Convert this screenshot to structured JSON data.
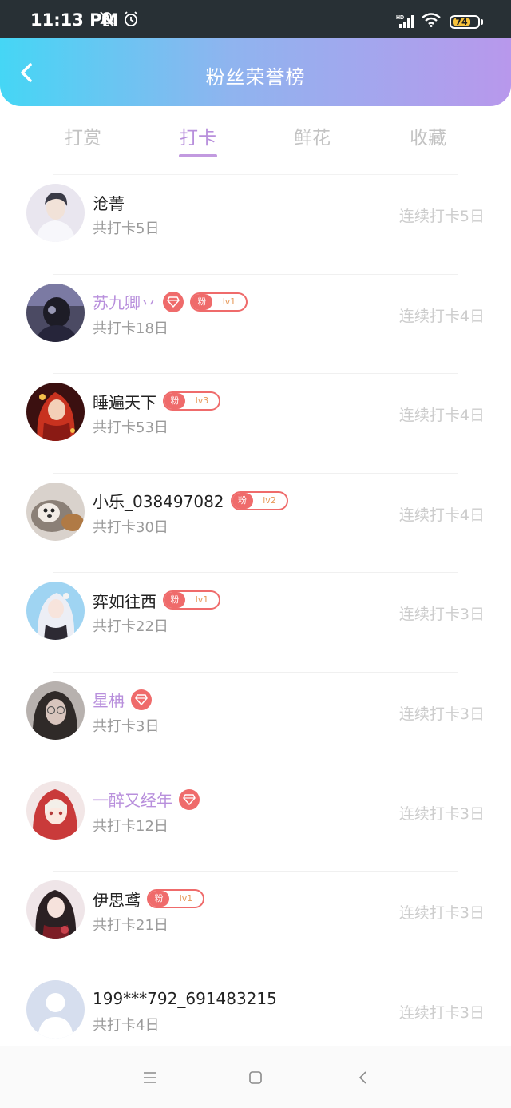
{
  "status_bar": {
    "time": "11:13 PM",
    "battery": "74",
    "battery_level": 0.74,
    "icons": [
      "mute-bell-icon",
      "alarm-icon",
      "hd-signal-icon",
      "wifi-icon",
      "battery-icon"
    ]
  },
  "header": {
    "title": "粉丝荣誉榜",
    "back_icon": "chevron-left-icon",
    "gradient": [
      "#45d6f5",
      "#b898ec"
    ]
  },
  "tabs": [
    {
      "label": "打赏",
      "active": false
    },
    {
      "label": "打卡",
      "active": true
    },
    {
      "label": "鲜花",
      "active": false
    },
    {
      "label": "收藏",
      "active": false
    }
  ],
  "accent_color": "#b88fdc",
  "badge_color": "#ef6b6b",
  "fan_badge_prefix": "粉",
  "users": [
    {
      "name": "沧菁",
      "vip": false,
      "diamond": false,
      "fan_level": "",
      "total": "共打卡5日",
      "streak": "连续打卡5日",
      "avatar": "avatar-man-white-shirt"
    },
    {
      "name": "苏九卿丷",
      "vip": true,
      "diamond": true,
      "fan_level": "lv1",
      "total": "共打卡18日",
      "streak": "连续打卡4日",
      "avatar": "avatar-dark-figure"
    },
    {
      "name": "睡遍天下",
      "vip": false,
      "diamond": false,
      "fan_level": "lv3",
      "total": "共打卡53日",
      "streak": "连续打卡4日",
      "avatar": "avatar-red-hair-anime"
    },
    {
      "name": "小乐_038497082",
      "vip": false,
      "diamond": false,
      "fan_level": "lv2",
      "total": "共打卡30日",
      "streak": "连续打卡4日",
      "avatar": "avatar-puppy"
    },
    {
      "name": "弈如往西",
      "vip": false,
      "diamond": false,
      "fan_level": "lv1",
      "total": "共打卡22日",
      "streak": "连续打卡3日",
      "avatar": "avatar-white-hair-anime"
    },
    {
      "name": "星柟",
      "vip": true,
      "diamond": true,
      "fan_level": "",
      "total": "共打卡3日",
      "streak": "连续打卡3日",
      "avatar": "avatar-girl-glasses"
    },
    {
      "name": "一醉又经年",
      "vip": true,
      "diamond": true,
      "fan_level": "",
      "total": "共打卡12日",
      "streak": "连续打卡3日",
      "avatar": "avatar-red-hood-anime"
    },
    {
      "name": "伊思鸢",
      "vip": false,
      "diamond": false,
      "fan_level": "lv1",
      "total": "共打卡21日",
      "streak": "连续打卡3日",
      "avatar": "avatar-dark-hair-anime"
    },
    {
      "name": "199***792_691483215",
      "vip": false,
      "diamond": false,
      "fan_level": "",
      "total": "共打卡4日",
      "streak": "连续打卡3日",
      "avatar": "avatar-default-silhouette"
    }
  ],
  "nav_bar": {
    "icons": [
      "menu-icon",
      "home-square-icon",
      "back-triangle-icon"
    ]
  }
}
